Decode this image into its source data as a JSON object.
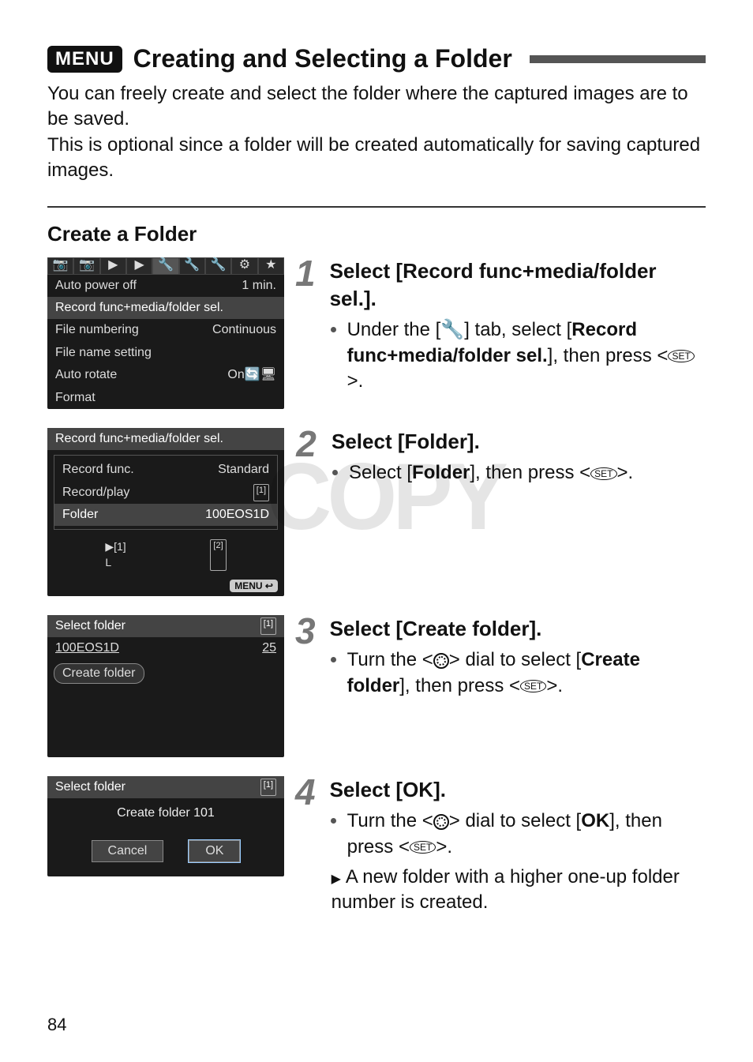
{
  "page_number": "84",
  "menu_badge": "MENU",
  "title": "Creating and Selecting a Folder",
  "intro_p1": "You can freely create and select the folder where the captured images are to be saved.",
  "intro_p2": "This is optional since a folder will be created automatically for saving captured images.",
  "subhead": "Create a Folder",
  "watermark": "COPY",
  "screens": {
    "s1": {
      "rows": [
        {
          "label": "Auto power off",
          "value": "1 min."
        },
        {
          "label": "Record func+media/folder sel.",
          "value": "",
          "selected": true
        },
        {
          "label": "File numbering",
          "value": "Continuous"
        },
        {
          "label": "File name setting",
          "value": ""
        },
        {
          "label": "Auto rotate",
          "value": "On🔄🖥"
        },
        {
          "label": "Format",
          "value": ""
        }
      ]
    },
    "s2": {
      "header": "Record func+media/folder sel.",
      "rows": [
        {
          "label": "Record func.",
          "value": "Standard"
        },
        {
          "label": "Record/play",
          "value": "[1]"
        },
        {
          "label": "Folder",
          "value": "100EOS1D",
          "selected": true
        }
      ],
      "icons_left": "▶[1]",
      "icons_left2": "L",
      "icons_right": "[2]",
      "back": "MENU ↩"
    },
    "s3": {
      "header": "Select folder",
      "card": "[1]",
      "existing": {
        "name": "100EOS1D",
        "count": "25"
      },
      "create": "Create folder"
    },
    "s4": {
      "header": "Select folder",
      "card": "[1]",
      "center": "Create folder 101",
      "cancel": "Cancel",
      "ok": "OK"
    }
  },
  "steps": {
    "n1": "1",
    "n2": "2",
    "n3": "3",
    "n4": "4",
    "s1_h": "Select [Record func+media/folder sel.].",
    "s1_b_pre": "Under the [",
    "s1_b_mid": "] tab, select [",
    "s1_b_item": "Record func+media/folder sel.",
    "s1_b_post": "], then press <",
    "s1_b_end": ">.",
    "wrench": "🔧",
    "set": "SET",
    "s2_h": "Select [Folder].",
    "s2_b_pre": "Select [",
    "s2_b_item": "Folder",
    "s2_b_post": "], then press <",
    "s2_b_end": ">.",
    "s3_h": "Select [Create folder].",
    "s3_b_pre": "Turn the <",
    "s3_b_mid": "> dial to select [",
    "s3_b_item": "Create folder",
    "s3_b_post": "], then press <",
    "s3_b_end": ">.",
    "s4_h": "Select [OK].",
    "s4_b1_pre": "Turn the <",
    "s4_b1_mid": "> dial to select [",
    "s4_b1_item": "OK",
    "s4_b1_post": "], then press <",
    "s4_b1_end": ">.",
    "s4_b2": "A new folder with a higher one-up folder number is created."
  }
}
